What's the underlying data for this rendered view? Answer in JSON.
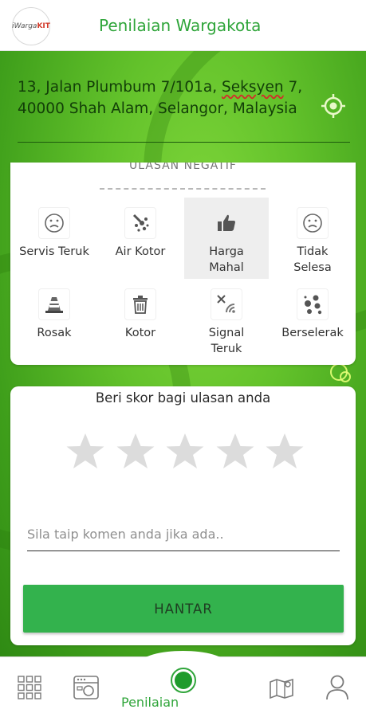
{
  "header": {
    "title": "Penilaian Wargakota",
    "logo_text": "iWarga",
    "logo_accent": "KIT"
  },
  "location": {
    "address_part1": "13, Jalan Plumbum 7/101a, ",
    "address_misspelled": "Seksyen",
    "address_part2": " 7, 40000 Shah Alam, Selangor, Malaysia"
  },
  "negative_review": {
    "heading": "ULASAN NEGATIF",
    "options": [
      {
        "label": "Servis Teruk",
        "icon": "sad-face-icon",
        "selected": false
      },
      {
        "label": "Air Kotor",
        "icon": "dirty-water-icon",
        "selected": false
      },
      {
        "label": "Harga Mahal",
        "icon": "thumbs-up-icon",
        "selected": true
      },
      {
        "label": "Tidak Selesa",
        "icon": "sad-face-icon",
        "selected": false
      },
      {
        "label": "Rosak",
        "icon": "traffic-cone-icon",
        "selected": false
      },
      {
        "label": "Kotor",
        "icon": "trash-icon",
        "selected": false
      },
      {
        "label": "Signal Teruk",
        "icon": "no-signal-icon",
        "selected": false
      },
      {
        "label": "Berselerak",
        "icon": "scattered-icon",
        "selected": false
      }
    ]
  },
  "rating": {
    "prompt": "Beri skor bagi ulasan anda",
    "stars": 5,
    "value": 0
  },
  "comment": {
    "placeholder": "Sila taip komen anda jika ada..",
    "value": ""
  },
  "submit_label": "HANTAR",
  "bottom_nav": {
    "active_label": "Penilaian",
    "items": [
      "grid-menu-icon",
      "dashboard-icon",
      "rating-record-icon",
      "map-icon",
      "profile-icon"
    ]
  },
  "colors": {
    "brand_green": "#2fa53a",
    "button_green": "#33b24d",
    "star_grey": "#dcdcdc"
  }
}
